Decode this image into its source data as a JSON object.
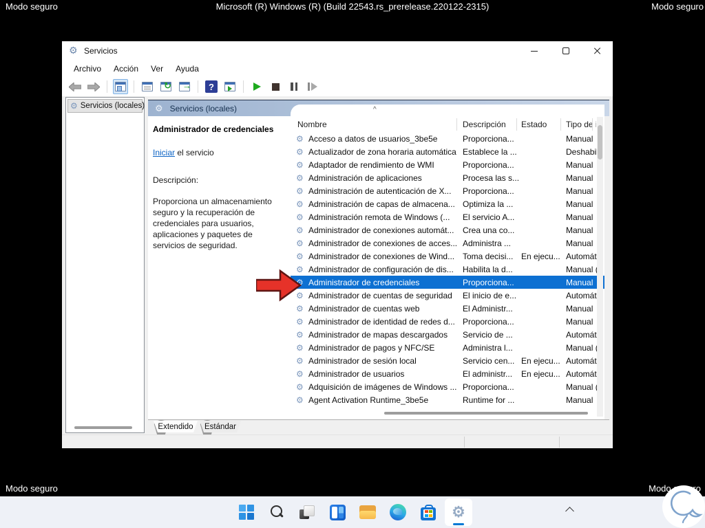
{
  "safe_mode": {
    "top_left": "Modo seguro",
    "top_center": "Microsoft (R) Windows (R) (Build 22543.rs_prerelease.220122-2315)",
    "top_right": "Modo seguro",
    "bottom_left": "Modo seguro",
    "bottom_right": "Modo seguro"
  },
  "window": {
    "title": "Servicios",
    "menu": [
      "Archivo",
      "Acción",
      "Ver",
      "Ayuda"
    ]
  },
  "tree": {
    "root_label": "Servicios (locales)"
  },
  "banner": {
    "title": "Servicios (locales)"
  },
  "info": {
    "service_title": "Administrador de credenciales",
    "action_link": "Iniciar",
    "action_rest": " el servicio",
    "description_label": "Descripción:",
    "description": "Proporciona un almacenamiento seguro y la recuperación de credenciales para usuarios, aplicaciones y paquetes de servicios de seguridad."
  },
  "list": {
    "columns": {
      "name": "Nombre",
      "description": "Descripción",
      "status": "Estado",
      "startup": "Tipo de in"
    },
    "selected_index": 11,
    "rows": [
      {
        "name": "Acceso a datos de usuarios_3be5e",
        "desc": "Proporciona...",
        "estado": "",
        "tipo": "Manual"
      },
      {
        "name": "Actualizador de zona horaria automática",
        "desc": "Establece la ...",
        "estado": "",
        "tipo": "Deshabilit"
      },
      {
        "name": "Adaptador de rendimiento de WMI",
        "desc": "Proporciona...",
        "estado": "",
        "tipo": "Manual"
      },
      {
        "name": "Administración de aplicaciones",
        "desc": "Procesa las s...",
        "estado": "",
        "tipo": "Manual"
      },
      {
        "name": "Administración de autenticación de X...",
        "desc": "Proporciona...",
        "estado": "",
        "tipo": "Manual"
      },
      {
        "name": "Administración de capas de almacena...",
        "desc": "Optimiza la ...",
        "estado": "",
        "tipo": "Manual"
      },
      {
        "name": "Administración remota de Windows (...",
        "desc": "El servicio A...",
        "estado": "",
        "tipo": "Manual"
      },
      {
        "name": "Administrador de conexiones automát...",
        "desc": "Crea una co...",
        "estado": "",
        "tipo": "Manual"
      },
      {
        "name": "Administrador de conexiones de acces...",
        "desc": "Administra ...",
        "estado": "",
        "tipo": "Manual"
      },
      {
        "name": "Administrador de conexiones de Wind...",
        "desc": "Toma decisi...",
        "estado": "En ejecu...",
        "tipo": "Automáti"
      },
      {
        "name": "Administrador de configuración de dis...",
        "desc": "Habilita la d...",
        "estado": "",
        "tipo": "Manual (c"
      },
      {
        "name": "Administrador de credenciales",
        "desc": "Proporciona...",
        "estado": "",
        "tipo": "Manual"
      },
      {
        "name": "Administrador de cuentas de seguridad",
        "desc": "El inicio de e...",
        "estado": "",
        "tipo": "Automáti"
      },
      {
        "name": "Administrador de cuentas web",
        "desc": "El Administr...",
        "estado": "",
        "tipo": "Manual"
      },
      {
        "name": "Administrador de identidad de redes d...",
        "desc": "Proporciona...",
        "estado": "",
        "tipo": "Manual"
      },
      {
        "name": "Administrador de mapas descargados",
        "desc": "Servicio de ...",
        "estado": "",
        "tipo": "Automáti"
      },
      {
        "name": "Administrador de pagos y NFC/SE",
        "desc": "Administra l...",
        "estado": "",
        "tipo": "Manual (c"
      },
      {
        "name": "Administrador de sesión local",
        "desc": "Servicio cen...",
        "estado": "En ejecu...",
        "tipo": "Automáti"
      },
      {
        "name": "Administrador de usuarios",
        "desc": "El administr...",
        "estado": "En ejecu...",
        "tipo": "Automáti"
      },
      {
        "name": "Adquisición de imágenes de Windows ...",
        "desc": "Proporciona...",
        "estado": "",
        "tipo": "Manual (c"
      },
      {
        "name": "Agent Activation Runtime_3be5e",
        "desc": "Runtime for ...",
        "estado": "",
        "tipo": "Manual"
      }
    ]
  },
  "tabs": {
    "extended": "Extendido",
    "standard": "Estándar"
  },
  "icons": {
    "gear": "⚙",
    "sort_caret": "^",
    "question": "?",
    "refresh": "↻",
    "arrow_right": "→"
  },
  "colors": {
    "selection": "#0d70d2",
    "accent": "#0078d4",
    "arrow_red": "#e63229",
    "banner_from": "#9db3d0",
    "banner_to": "#c9d6e8",
    "taskbar_bg": "#eef1f7"
  }
}
